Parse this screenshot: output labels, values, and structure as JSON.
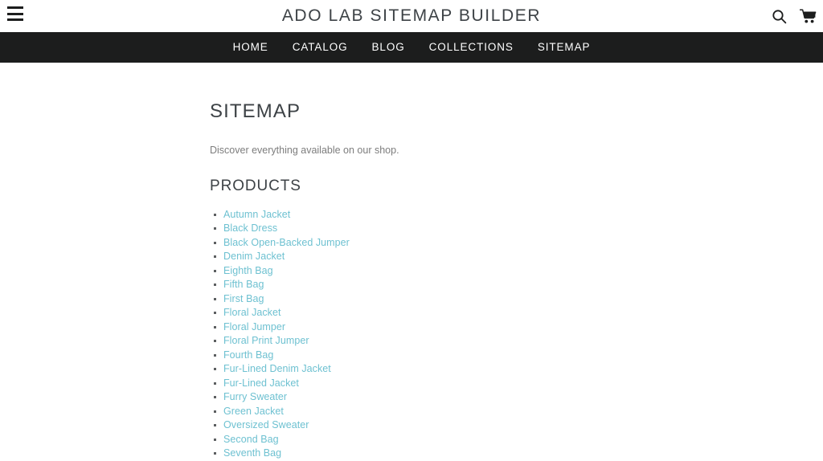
{
  "header": {
    "title": "ADO LAB SITEMAP BUILDER",
    "menu_icon": "hamburger-menu-icon",
    "search_icon": "search-icon",
    "cart_icon": "shopping-cart-icon"
  },
  "nav": {
    "items": [
      {
        "label": "HOME"
      },
      {
        "label": "CATALOG"
      },
      {
        "label": "BLOG"
      },
      {
        "label": "COLLECTIONS"
      },
      {
        "label": "SITEMAP"
      }
    ]
  },
  "main": {
    "page_heading": "SITEMAP",
    "subtitle": "Discover everything available on our shop.",
    "section_heading": "PRODUCTS",
    "products": [
      {
        "label": "Autumn Jacket"
      },
      {
        "label": "Black Dress"
      },
      {
        "label": "Black Open-Backed Jumper"
      },
      {
        "label": "Denim Jacket"
      },
      {
        "label": "Eighth Bag"
      },
      {
        "label": "Fifth Bag"
      },
      {
        "label": "First Bag"
      },
      {
        "label": "Floral Jacket"
      },
      {
        "label": "Floral Jumper"
      },
      {
        "label": "Floral Print Jumper"
      },
      {
        "label": "Fourth Bag"
      },
      {
        "label": "Fur-Lined Denim Jacket"
      },
      {
        "label": "Fur-Lined Jacket"
      },
      {
        "label": "Furry Sweater"
      },
      {
        "label": "Green Jacket"
      },
      {
        "label": "Oversized Sweater"
      },
      {
        "label": "Second Bag"
      },
      {
        "label": "Seventh Bag"
      }
    ]
  },
  "colors": {
    "nav_background": "#1c1d1d",
    "link": "#6ec1d1",
    "text": "#3d4246",
    "muted_text": "#7d7d7d"
  }
}
